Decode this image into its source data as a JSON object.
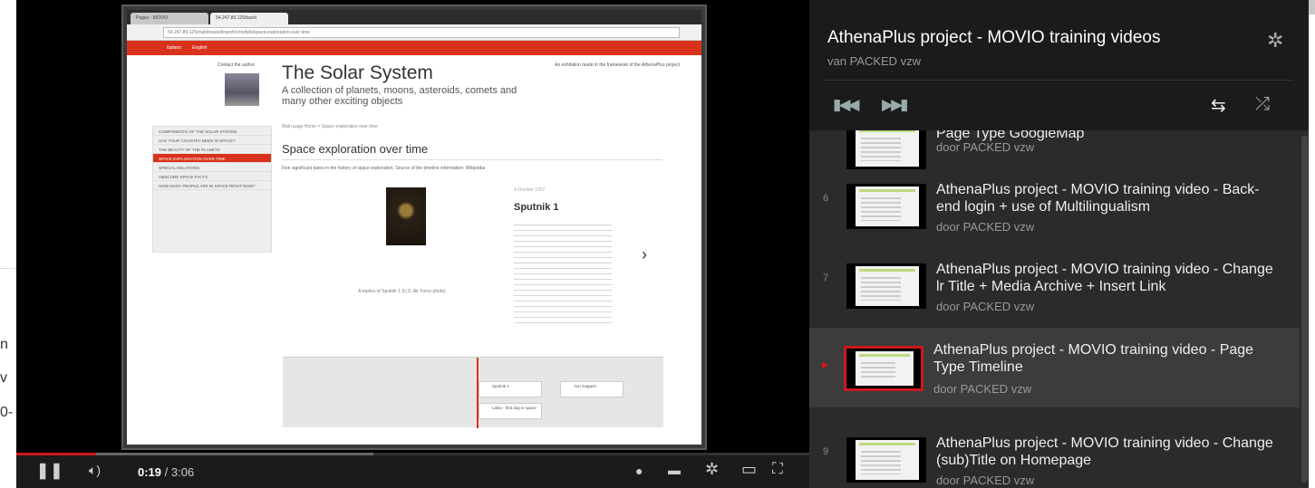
{
  "page": {
    "fragments": [
      "n",
      "v",
      "0-"
    ]
  },
  "video": {
    "browser": {
      "tabs": [
        "Pages - MOVIO",
        "54.247.89.125/backl"
      ],
      "url": "54.247.89.125/multimovio/branch/cms/tpls/space-exploration-over-time",
      "nav_links": [
        "Italiano",
        "English"
      ],
      "contact": "Contact the author",
      "title": "The Solar System",
      "subtitle": "A collection of planets, moons, asteroids, comets and many other exciting objects",
      "note": "An exhibition made in the framework of the AthenaPlus project",
      "menu": [
        "COMPONENTS OF THE SOLAR SYSTEM",
        "HAS YOUR COUNTRY BEEN IN SPACE?",
        "THE BEAUTY OF THE PLANETS",
        "SPACE EXPLORATION OVER TIME",
        "SPECIAL RELATIONS",
        "OBSCURE SPACE FACTS",
        "HOW MANY PEOPLE ARE IN SPACE RIGHT NOW?"
      ],
      "menu_active_index": 3,
      "breadcrumb": "Main page Home > Space exploration over time",
      "section_title": "Space exploration over time",
      "section_desc": "Five significant dates in the history of space exploration. Source of the timeline information: Wikipedia",
      "event_date": "4 October 1957",
      "event_title": "Sputnik 1",
      "image_caption": "A replica of Sputnik 1 (U.S. Air Force photo)",
      "timeline_cards": [
        "Sputnik 1",
        "Laika - first dog in space",
        "Yuri Gagarin"
      ]
    },
    "controls": {
      "current_time": "0:19",
      "duration": "/ 3:06",
      "progress": 0.1,
      "loaded": 0.45
    }
  },
  "playlist": {
    "title": "AthenaPlus project - MOVIO training videos",
    "owner": "van PACKED vzw",
    "items": [
      {
        "num": "",
        "title": "Page Type GoogleMap",
        "by": "door PACKED vzw"
      },
      {
        "num": "6",
        "title": "AthenaPlus project - MOVIO training video - Back-end login + use of Multilingualism",
        "by": "door PACKED vzw"
      },
      {
        "num": "7",
        "title": "AthenaPlus project - MOVIO training video - Change lr Title + Media Archive + Insert Link",
        "by": "door PACKED vzw"
      },
      {
        "num": "",
        "title": "AthenaPlus project - MOVIO training video - Page Type Timeline",
        "by": "door PACKED vzw",
        "current": true
      },
      {
        "num": "9",
        "title": "AthenaPlus project - MOVIO training video - Change (sub)Title on Homepage",
        "by": "door PACKED vzw"
      }
    ]
  },
  "colors": {
    "accent": "#cc181e",
    "site_red": "#d9321c",
    "panel": "#2b2b2b"
  }
}
